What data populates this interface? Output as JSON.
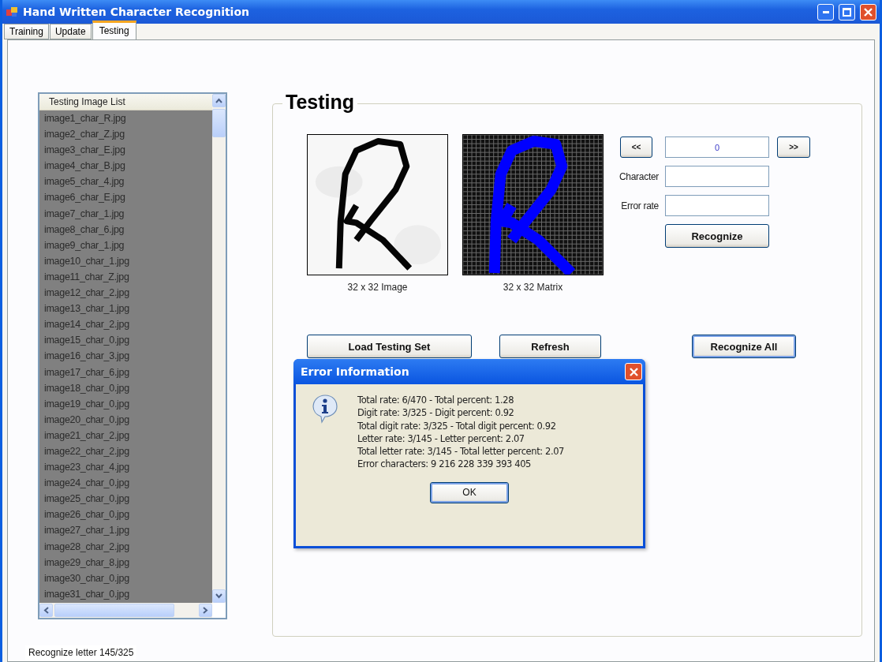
{
  "window": {
    "title": "Hand Written Character Recognition"
  },
  "tabs": [
    {
      "label": "Training",
      "selected": false
    },
    {
      "label": "Update",
      "selected": false
    },
    {
      "label": "Testing",
      "selected": true
    }
  ],
  "image_list": {
    "header": "Testing Image List",
    "items": [
      "image1_char_R.jpg",
      "image2_char_Z.jpg",
      "image3_char_E.jpg",
      "image4_char_B.jpg",
      "image5_char_4.jpg",
      "image6_char_E.jpg",
      "image7_char_1.jpg",
      "image8_char_6.jpg",
      "image9_char_1.jpg",
      "image10_char_1.jpg",
      "image11_char_Z.jpg",
      "image12_char_2.jpg",
      "image13_char_1.jpg",
      "image14_char_2.jpg",
      "image15_char_0.jpg",
      "image16_char_3.jpg",
      "image17_char_6.jpg",
      "image18_char_0.jpg",
      "image19_char_0.jpg",
      "image20_char_0.jpg",
      "image21_char_2.jpg",
      "image22_char_2.jpg",
      "image23_char_4.jpg",
      "image24_char_0.jpg",
      "image25_char_0.jpg",
      "image26_char_0.jpg",
      "image27_char_1.jpg",
      "image28_char_2.jpg",
      "image29_char_8.jpg",
      "image30_char_0.jpg",
      "image31_char_0.jpg"
    ]
  },
  "testing": {
    "title": "Testing",
    "image_caption": "32 x 32 Image",
    "matrix_caption": "32 x 32 Matrix",
    "prev_button": "<<",
    "index_value": "0",
    "next_button": ">>",
    "character_label": "Character",
    "error_rate_label": "Error rate",
    "recognize_button": "Recognize",
    "load_button": "Load Testing Set",
    "refresh_button": "Refresh",
    "recognize_all_button": "Recognize All"
  },
  "status": "Recognize letter 145/325",
  "dialog": {
    "title": "Error Information",
    "lines": [
      "Total rate: 6/470 - Total percent: 1.28",
      "Digit rate: 3/325 - Digit percent: 0.92",
      "Total digit rate: 3/325 - Total digit percent: 0.92",
      "Letter rate: 3/145 - Letter percent: 2.07",
      "Total letter rate: 3/145 - Total letter percent: 2.07",
      "Error characters: 9 216 228 339 393 405"
    ],
    "button": "OK"
  }
}
